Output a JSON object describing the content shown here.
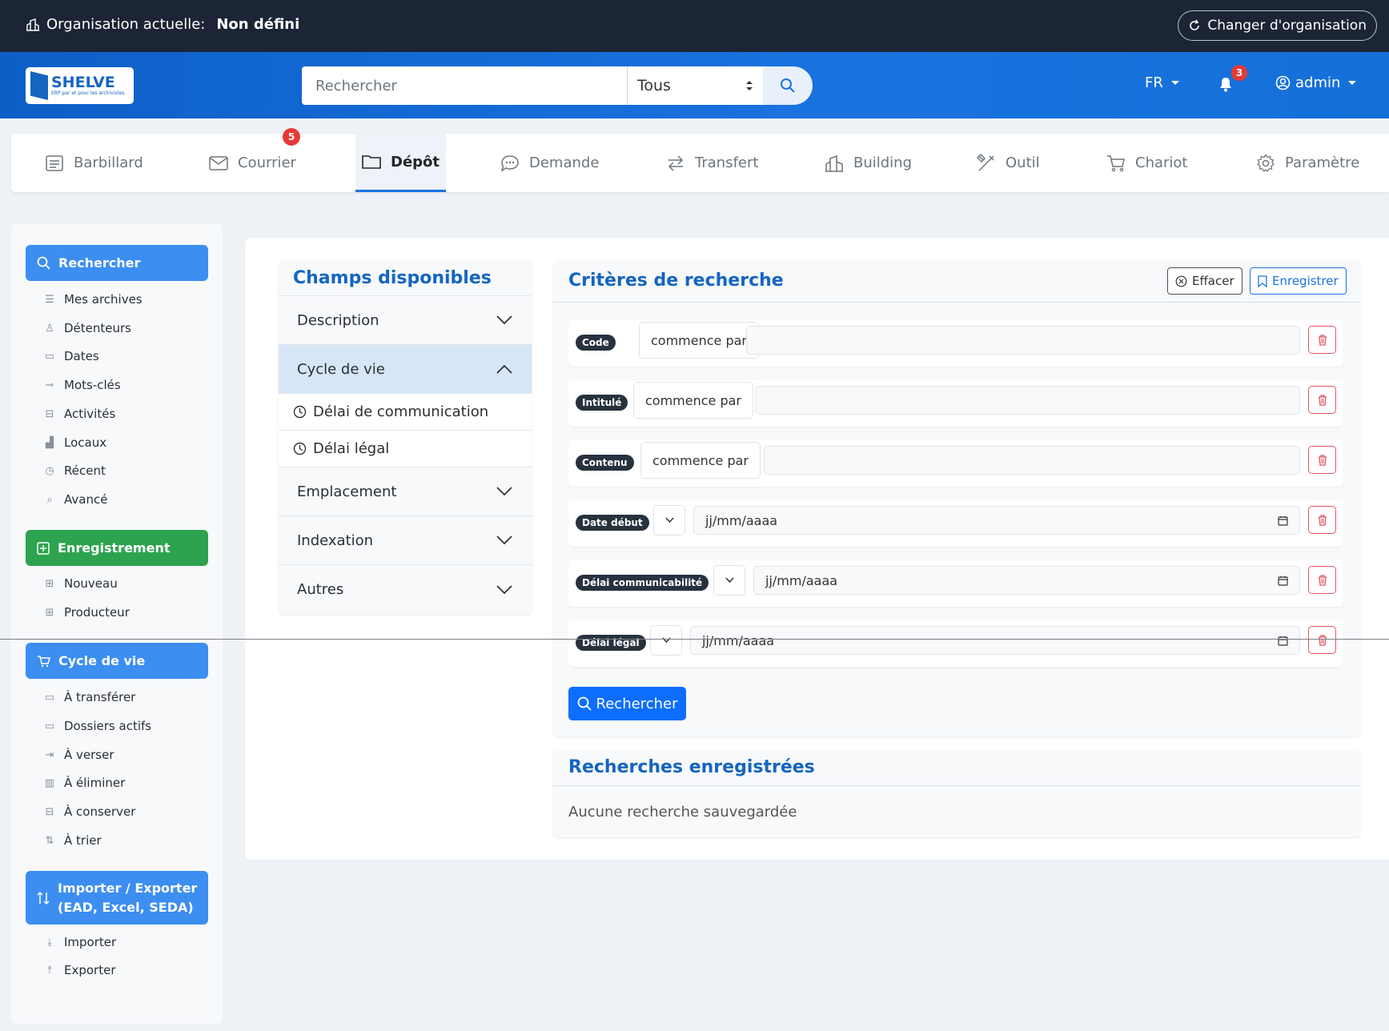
{
  "topbar": {
    "org_label": "Organisation actuelle:",
    "org_value": "Non défini",
    "switch_label": "Changer d'organisation"
  },
  "header": {
    "logo_title": "SHELVE",
    "logo_subtitle": "ERP par et pour les archivistes",
    "search_placeholder": "Rechercher",
    "search_scope": "Tous",
    "lang": "FR",
    "notif_count": "3",
    "user": "admin"
  },
  "nav": {
    "items": [
      {
        "label": "Barbillard",
        "icon": "clipboard-icon"
      },
      {
        "label": "Courrier",
        "icon": "mail-icon",
        "badge": "5"
      },
      {
        "label": "Dépôt",
        "icon": "folder-icon",
        "active": true
      },
      {
        "label": "Demande",
        "icon": "chat-icon"
      },
      {
        "label": "Transfert",
        "icon": "transfer-icon"
      },
      {
        "label": "Building",
        "icon": "building-icon"
      },
      {
        "label": "Outil",
        "icon": "tools-icon"
      },
      {
        "label": "Chariot",
        "icon": "cart-icon"
      },
      {
        "label": "Paramètre",
        "icon": "gear-icon"
      }
    ]
  },
  "sidebar": {
    "search_head": "Rechercher",
    "search_links": [
      "Mes archives",
      "Détenteurs",
      "Dates",
      "Mots-clés",
      "Activités",
      "Locaux",
      "Récent",
      "Avancé"
    ],
    "record_head": "Enregistrement",
    "record_links": [
      "Nouveau",
      "Producteur"
    ],
    "lifecycle_head": "Cycle de vie",
    "lifecycle_links": [
      "À transférer",
      "Dossiers actifs",
      "À verser",
      "À éliminer",
      "À conserver",
      "À trier"
    ],
    "io_head_1": "Importer / Exporter",
    "io_head_2": "(EAD, Excel, SEDA)",
    "io_links": [
      "Importer",
      "Exporter"
    ]
  },
  "fields": {
    "title": "Champs disponibles",
    "groups": [
      "Description",
      "Cycle de vie",
      "Emplacement",
      "Indexation",
      "Autres"
    ],
    "lifecycle_items": [
      "Délai de communication",
      "Délai légal"
    ]
  },
  "criteria": {
    "title": "Critères de recherche",
    "clear_label": "Effacer",
    "save_label": "Enregistrer",
    "rows": [
      {
        "label": "Code",
        "operator": "commence par",
        "value": ""
      },
      {
        "label": "Intitulé",
        "operator": "commence par",
        "value": ""
      },
      {
        "label": "Contenu",
        "operator": "commence par",
        "value": ""
      },
      {
        "label": "Date début",
        "operator": "",
        "value": "jj/mm/aaaa"
      },
      {
        "label": "Délai communicabilité",
        "operator": "",
        "value": "jj/mm/aaaa"
      },
      {
        "label": "Délai légal",
        "operator": "",
        "value": "jj/mm/aaaa"
      }
    ],
    "search_label": "Rechercher"
  },
  "saved": {
    "title": "Recherches enregistrées",
    "empty": "Aucune recherche sauvegardée"
  },
  "colors": {
    "primary": "#1565c0",
    "header_blue": "#1a73e0",
    "dark": "#1b2535",
    "green": "#2ea34f",
    "danger": "#e05561"
  }
}
